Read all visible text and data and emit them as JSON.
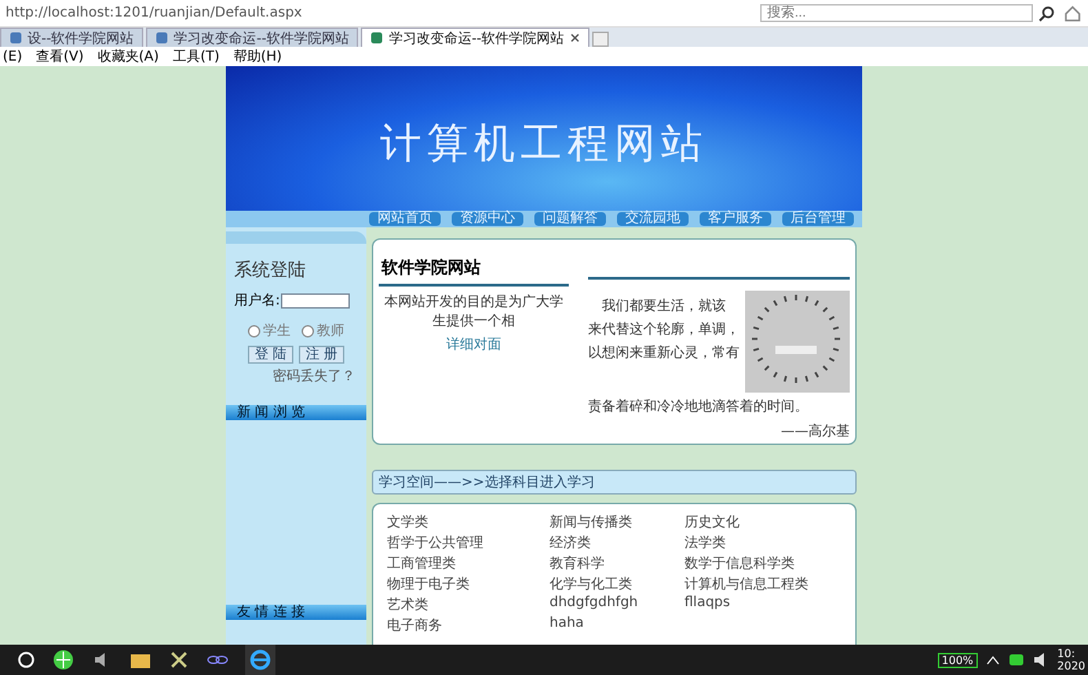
{
  "browser": {
    "address": "http://localhost:1201/ruanjian/Default.aspx",
    "search": {
      "placeholder": "搜索..."
    },
    "tabs": [
      {
        "label": "设--软件学院网站",
        "selected": false
      },
      {
        "label": "学习改变命运--软件学院网站",
        "selected": false
      },
      {
        "label": "学习改变命运--软件学院网站",
        "selected": true
      }
    ],
    "menu": [
      "(E)",
      "查看(V)",
      "收藏夹(A)",
      "工具(T)",
      "帮助(H)"
    ]
  },
  "site": {
    "banner_title": "计算机工程网站",
    "nav": [
      "网站首页",
      "资源中心",
      "问题解答",
      "交流园地",
      "客户服务",
      "后台管理"
    ],
    "login": {
      "title": "系统登陆",
      "username_label": "用户名:",
      "roles": [
        {
          "label": "学生",
          "selected": false
        },
        {
          "label": "教师",
          "selected": false
        }
      ],
      "buttons": [
        "登 陆",
        "注 册"
      ],
      "forgot": "密码丢失了？"
    },
    "sidebar_headers": [
      "新 闻 浏 览",
      "友 情 连 接"
    ],
    "intro": {
      "title": "软件学院网站",
      "text": "本网站开发的目的是为广大学生提供一个相",
      "link": "详细对面",
      "quote_lines": [
        "我们都要生活，就该",
        "来代替这个轮廓，单调，",
        "以想闲来重新心灵，常有",
        "责备着碎和冷冷地地滴答着的时间。"
      ],
      "quote_author": "——高尔基"
    },
    "study": {
      "header": "学习空间——>>选择科目进入学习",
      "subjects": [
        "文学类",
        "新闻与传播类",
        "历史文化",
        "哲学于公共管理",
        "经济类",
        "法学类",
        "工商管理类",
        "教育科学",
        "数学于信息科学类",
        "物理于电子类",
        "化学与化工类",
        "计算机与信息工程类",
        "艺术类",
        "dhdgfgdhfgh",
        "fllaqps",
        "电子商务",
        "haha"
      ]
    }
  },
  "taskbar": {
    "battery": "100%",
    "clock": [
      "10:",
      "2020"
    ]
  }
}
